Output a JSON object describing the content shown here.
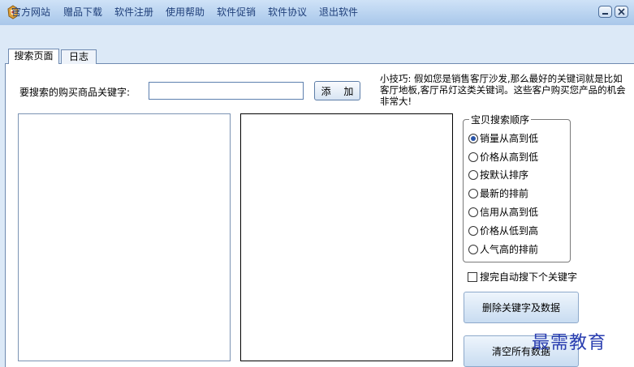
{
  "titlebar": {
    "title": "",
    "app_icon": "app-icon",
    "buttons": [
      "minimize-icon",
      "close-icon"
    ]
  },
  "menu": {
    "items": [
      "官方网站",
      "赠品下载",
      "软件注册",
      "使用帮助",
      "软件促销",
      "软件协议",
      "退出软件"
    ]
  },
  "tabs": [
    {
      "label": "搜索页面",
      "active": true
    },
    {
      "label": "日志",
      "active": false
    }
  ],
  "search": {
    "label": "要搜索的购买商品关键字:",
    "input_value": "",
    "add_label": "添 加"
  },
  "tip": "小技巧: 假如您是销售客厅沙发,那么最好的关键词就是比如客厅地板,客厅吊灯这类关键词。这些客户购买您产品的机会非常大!",
  "sort_group": {
    "legend": "宝贝搜索顺序",
    "options": [
      {
        "label": "销量从高到低",
        "checked": true
      },
      {
        "label": "价格从高到低",
        "checked": false
      },
      {
        "label": "按默认排序",
        "checked": false
      },
      {
        "label": "最新的排前",
        "checked": false
      },
      {
        "label": "信用从高到低",
        "checked": false
      },
      {
        "label": "价格从低到高",
        "checked": false
      },
      {
        "label": "人气高的排前",
        "checked": false
      }
    ]
  },
  "auto_next": {
    "label": "搜完自动搜下个关键字",
    "checked": false
  },
  "buttons": {
    "delete_label": "删除关键字及数据",
    "clear_label": "清空所有数据"
  },
  "watermark": "最需教育",
  "colors": {
    "accent": "#2a55a8",
    "menu_text": "#1f3f7a",
    "watermark": "#2a3eb0"
  }
}
